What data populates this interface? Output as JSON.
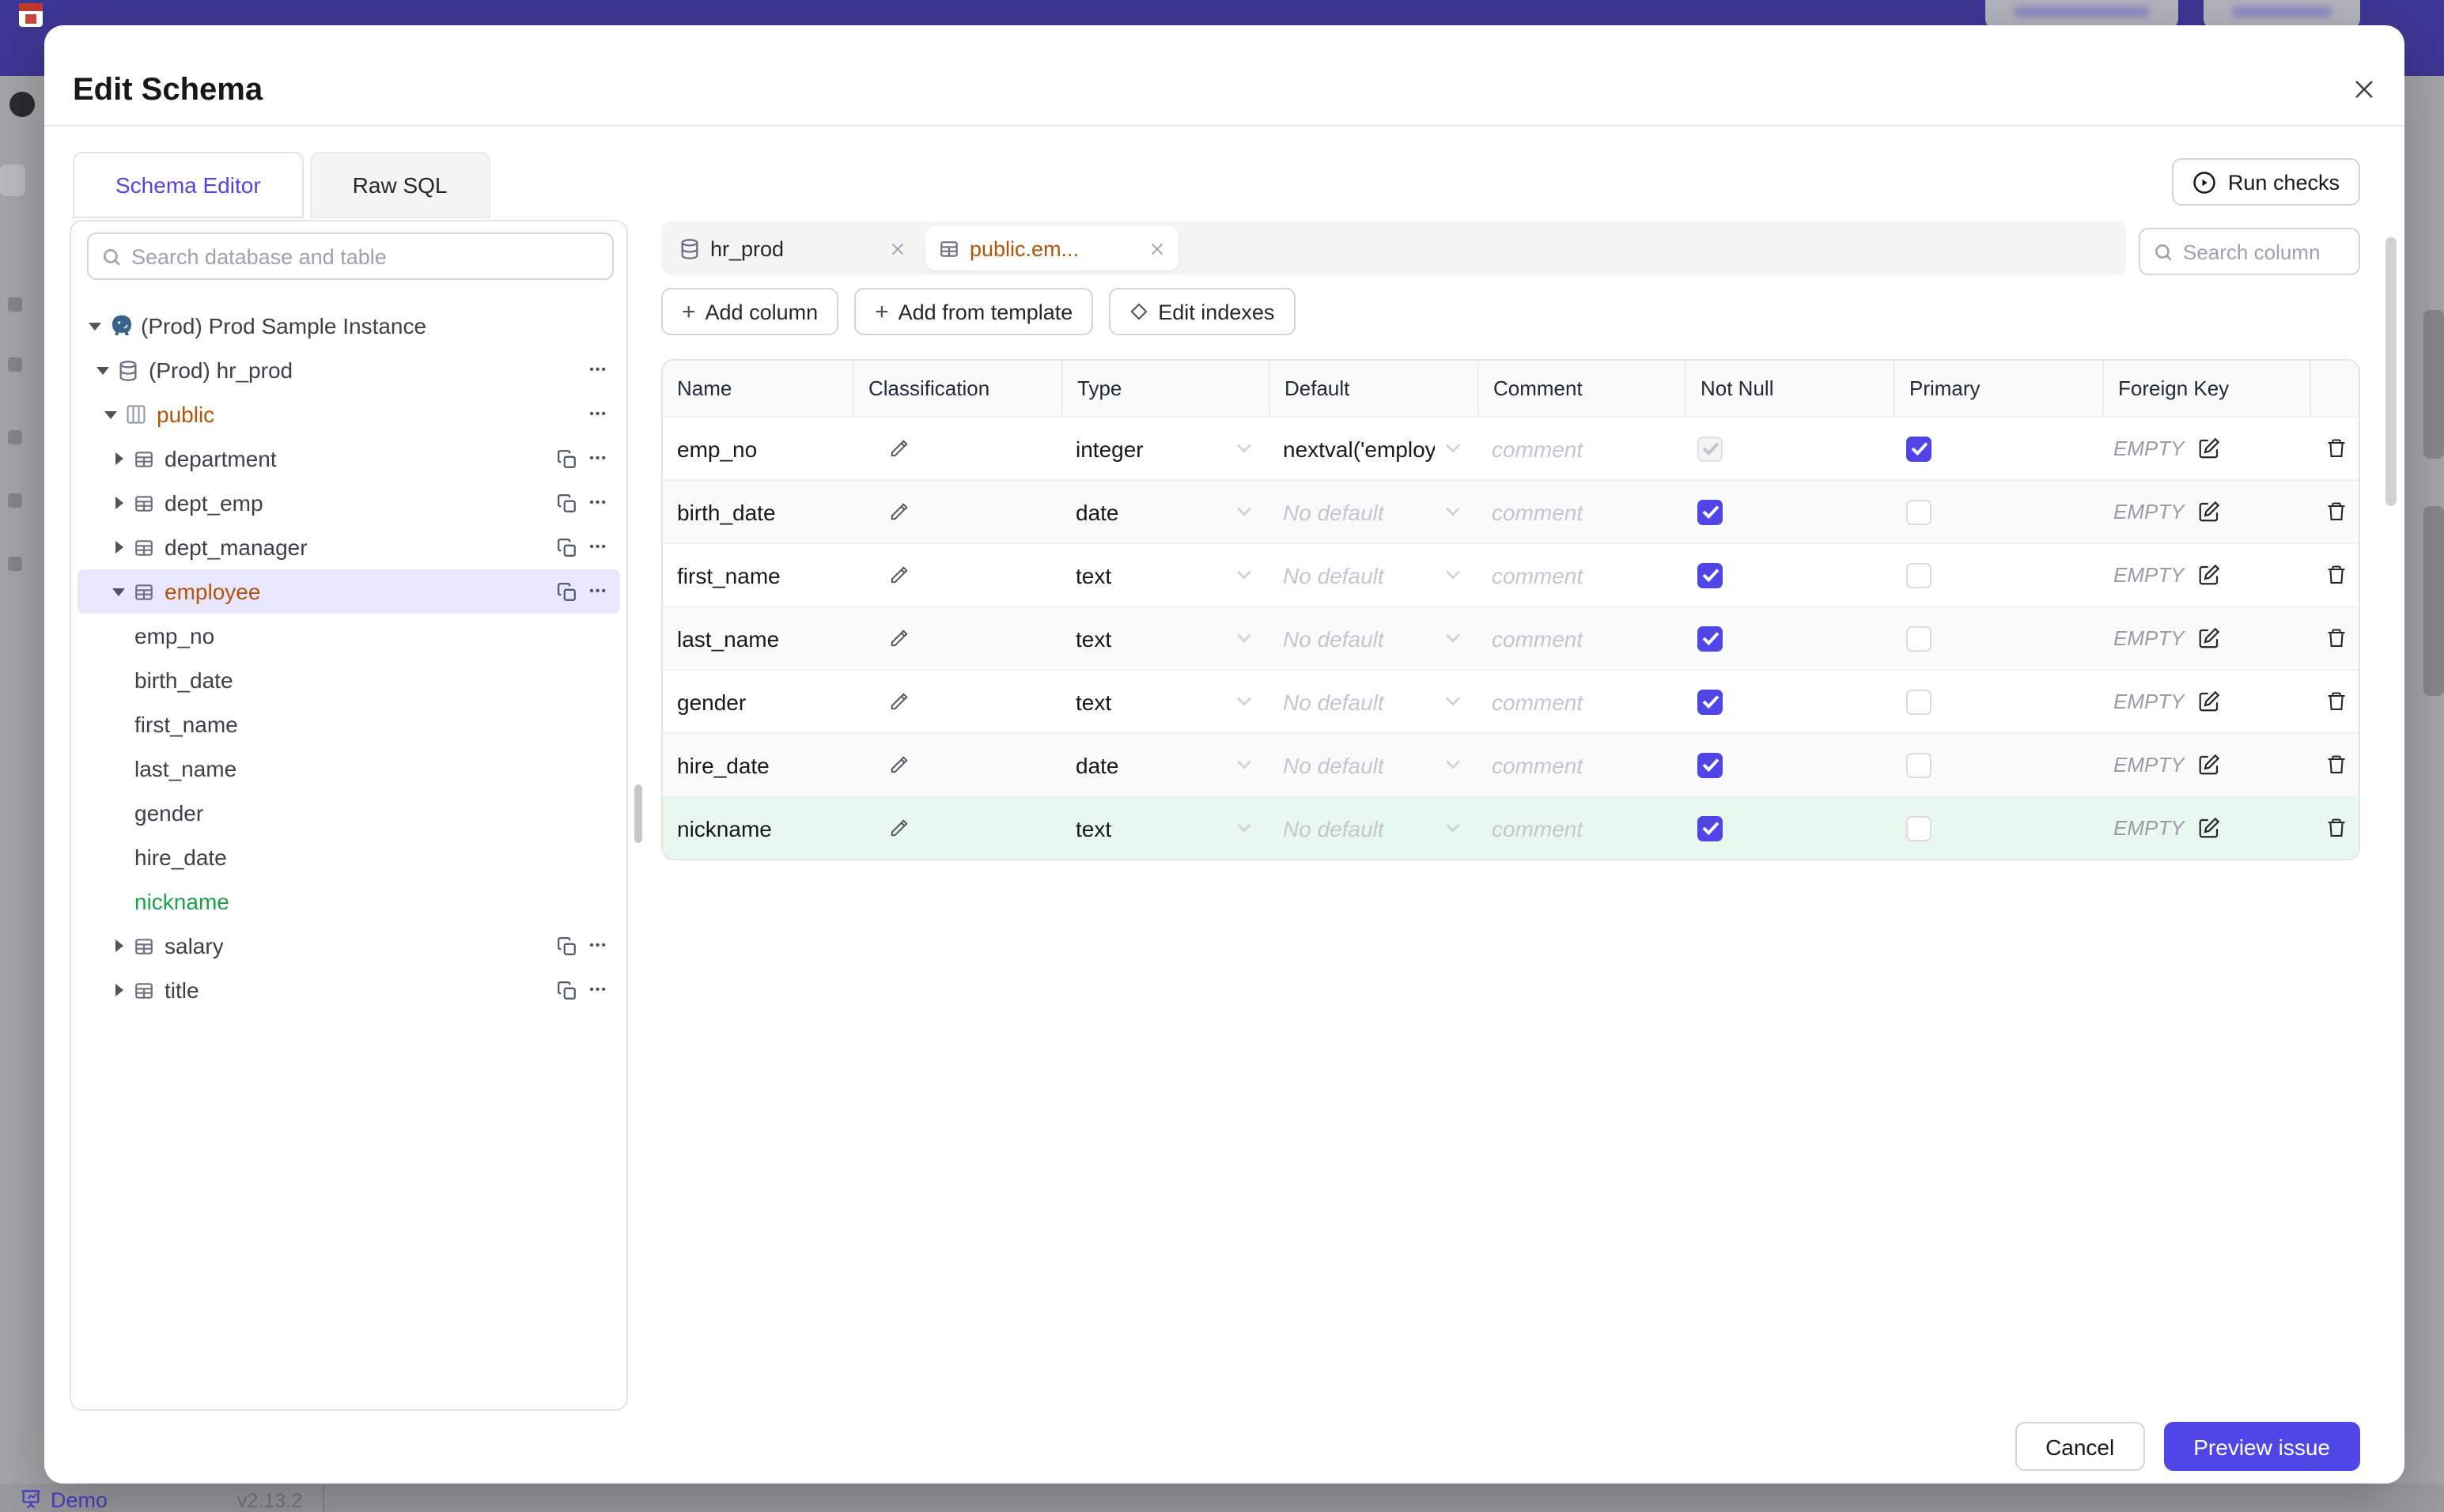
{
  "backdrop": {
    "demo_label": "Demo",
    "version": "v2.13.2"
  },
  "modal": {
    "title": "Edit Schema",
    "main_tabs": [
      {
        "label": "Schema Editor",
        "active": true
      },
      {
        "label": "Raw SQL",
        "active": false
      }
    ],
    "run_checks_label": "Run checks",
    "sidebar": {
      "search_placeholder": "Search database and table",
      "tree": [
        {
          "label": "(Prod) Prod Sample Instance",
          "level": 0,
          "icon": "postgres",
          "caret": "down"
        },
        {
          "label": "(Prod) hr_prod",
          "level": 1,
          "icon": "database",
          "caret": "down",
          "menu": true
        },
        {
          "label": "public",
          "level": 2,
          "icon": "schema",
          "caret": "down",
          "menu": true,
          "state": "modified"
        },
        {
          "label": "department",
          "level": 3,
          "icon": "table",
          "caret": "right",
          "copy": true,
          "menu": true
        },
        {
          "label": "dept_emp",
          "level": 3,
          "icon": "table",
          "caret": "right",
          "copy": true,
          "menu": true
        },
        {
          "label": "dept_manager",
          "level": 3,
          "icon": "table",
          "caret": "right",
          "copy": true,
          "menu": true
        },
        {
          "label": "employee",
          "level": 3,
          "icon": "table",
          "caret": "down",
          "copy": true,
          "menu": true,
          "state": "modified",
          "selected": true
        },
        {
          "label": "emp_no",
          "level": 4
        },
        {
          "label": "birth_date",
          "level": 4
        },
        {
          "label": "first_name",
          "level": 4
        },
        {
          "label": "last_name",
          "level": 4
        },
        {
          "label": "gender",
          "level": 4
        },
        {
          "label": "hire_date",
          "level": 4
        },
        {
          "label": "nickname",
          "level": 4,
          "state": "created"
        },
        {
          "label": "salary",
          "level": 3,
          "icon": "table",
          "caret": "right",
          "copy": true,
          "menu": true
        },
        {
          "label": "title",
          "level": 3,
          "icon": "table",
          "caret": "right",
          "copy": true,
          "menu": true
        }
      ]
    },
    "editor": {
      "tabs": [
        {
          "label": "hr_prod",
          "icon": "database",
          "active": false
        },
        {
          "label": "public.em...",
          "icon": "table",
          "active": true,
          "modified": true
        }
      ],
      "column_search_placeholder": "Search column",
      "actions": [
        {
          "label": "Add column",
          "icon": "plus"
        },
        {
          "label": "Add from template",
          "icon": "plus"
        },
        {
          "label": "Edit indexes",
          "icon": "diamond"
        }
      ],
      "table": {
        "headers": [
          "Name",
          "Classification",
          "Type",
          "Default",
          "Comment",
          "Not Null",
          "Primary",
          "Foreign Key",
          ""
        ],
        "comment_placeholder": "comment",
        "no_default_placeholder": "No default",
        "foreign_key_empty": "EMPTY",
        "rows": [
          {
            "name": "emp_no",
            "type": "integer",
            "default_value": "nextval('employ",
            "not_null": "disabled-checked",
            "primary": true,
            "is_new": false
          },
          {
            "name": "birth_date",
            "type": "date",
            "default_value": null,
            "not_null": "checked",
            "primary": false,
            "is_new": false
          },
          {
            "name": "first_name",
            "type": "text",
            "default_value": null,
            "not_null": "checked",
            "primary": false,
            "is_new": false
          },
          {
            "name": "last_name",
            "type": "text",
            "default_value": null,
            "not_null": "checked",
            "primary": false,
            "is_new": false
          },
          {
            "name": "gender",
            "type": "text",
            "default_value": null,
            "not_null": "checked",
            "primary": false,
            "is_new": false
          },
          {
            "name": "hire_date",
            "type": "date",
            "default_value": null,
            "not_null": "checked",
            "primary": false,
            "is_new": false
          },
          {
            "name": "nickname",
            "type": "text",
            "default_value": null,
            "not_null": "checked",
            "primary": false,
            "is_new": true
          }
        ]
      }
    },
    "footer": {
      "cancel_label": "Cancel",
      "submit_label": "Preview issue"
    }
  },
  "colors": {
    "accent": "#4f46e5",
    "modified_text": "#b45309",
    "created_text": "#16a34a",
    "banner": "#3d3795",
    "selected_tree_bg": "#e9e7fd",
    "new_row_bg": "#e9f8ef"
  }
}
